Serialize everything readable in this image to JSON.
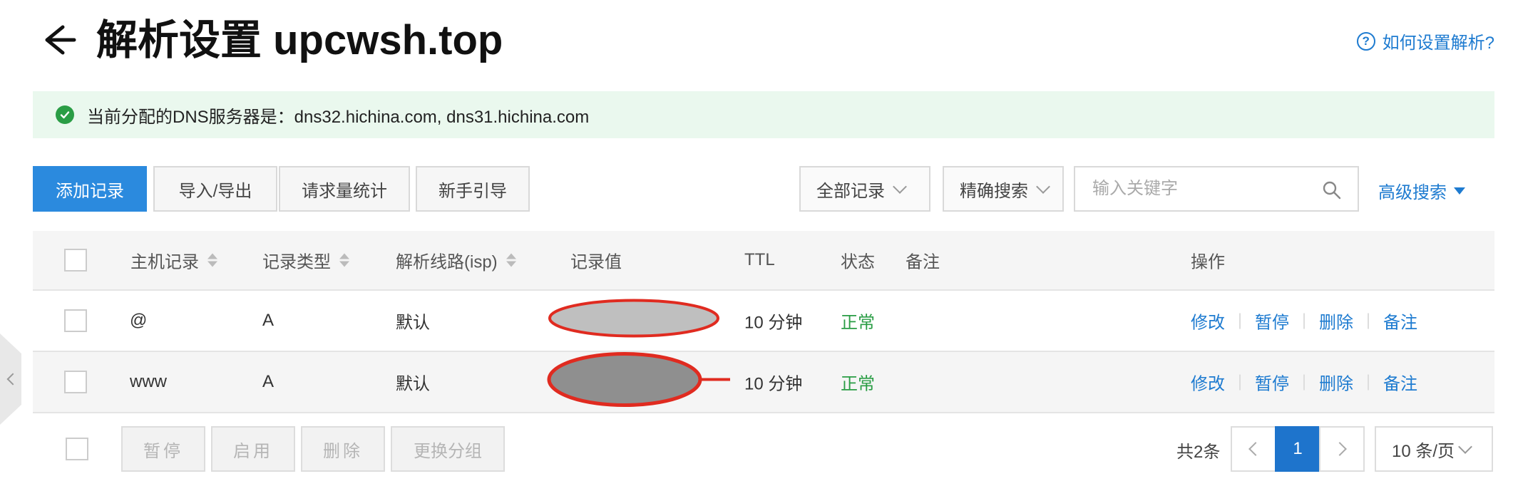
{
  "header": {
    "title": "解析设置 upcwsh.top",
    "help_link": "如何设置解析?"
  },
  "banner": {
    "text": "当前分配的DNS服务器是：dns32.hichina.com, dns31.hichina.com",
    "status_color": "#2a9d45"
  },
  "toolbar": {
    "add_record": "添加记录",
    "import_export": "导入/导出",
    "request_stats": "请求量统计",
    "beginner_guide": "新手引导",
    "record_filter": "全部记录",
    "search_mode": "精确搜索",
    "search_placeholder": "输入关键字",
    "advanced_search": "高级搜索"
  },
  "table": {
    "columns": {
      "host": "主机记录",
      "type": "记录类型",
      "line": "解析线路(isp)",
      "value": "记录值",
      "ttl": "TTL",
      "status": "状态",
      "remark": "备注",
      "actions": "操作"
    },
    "rows": [
      {
        "host": "@",
        "type": "A",
        "line": "默认",
        "value_redacted": true,
        "ttl": "10 分钟",
        "status": "正常"
      },
      {
        "host": "www",
        "type": "A",
        "line": "默认",
        "value_redacted": true,
        "ttl": "10 分钟",
        "status": "正常"
      }
    ],
    "row_actions": {
      "edit": "修改",
      "pause": "暂停",
      "delete": "删除",
      "remark": "备注"
    }
  },
  "footer": {
    "pause": "暂停",
    "enable": "启用",
    "delete": "删除",
    "change_group": "更换分组",
    "total": "共2条",
    "current_page": "1",
    "page_size": "10 条/页"
  },
  "colors": {
    "primary": "#2b8ade",
    "link": "#1e7bd0",
    "success": "#2a9d45",
    "redaction_outline": "#e02b20"
  }
}
